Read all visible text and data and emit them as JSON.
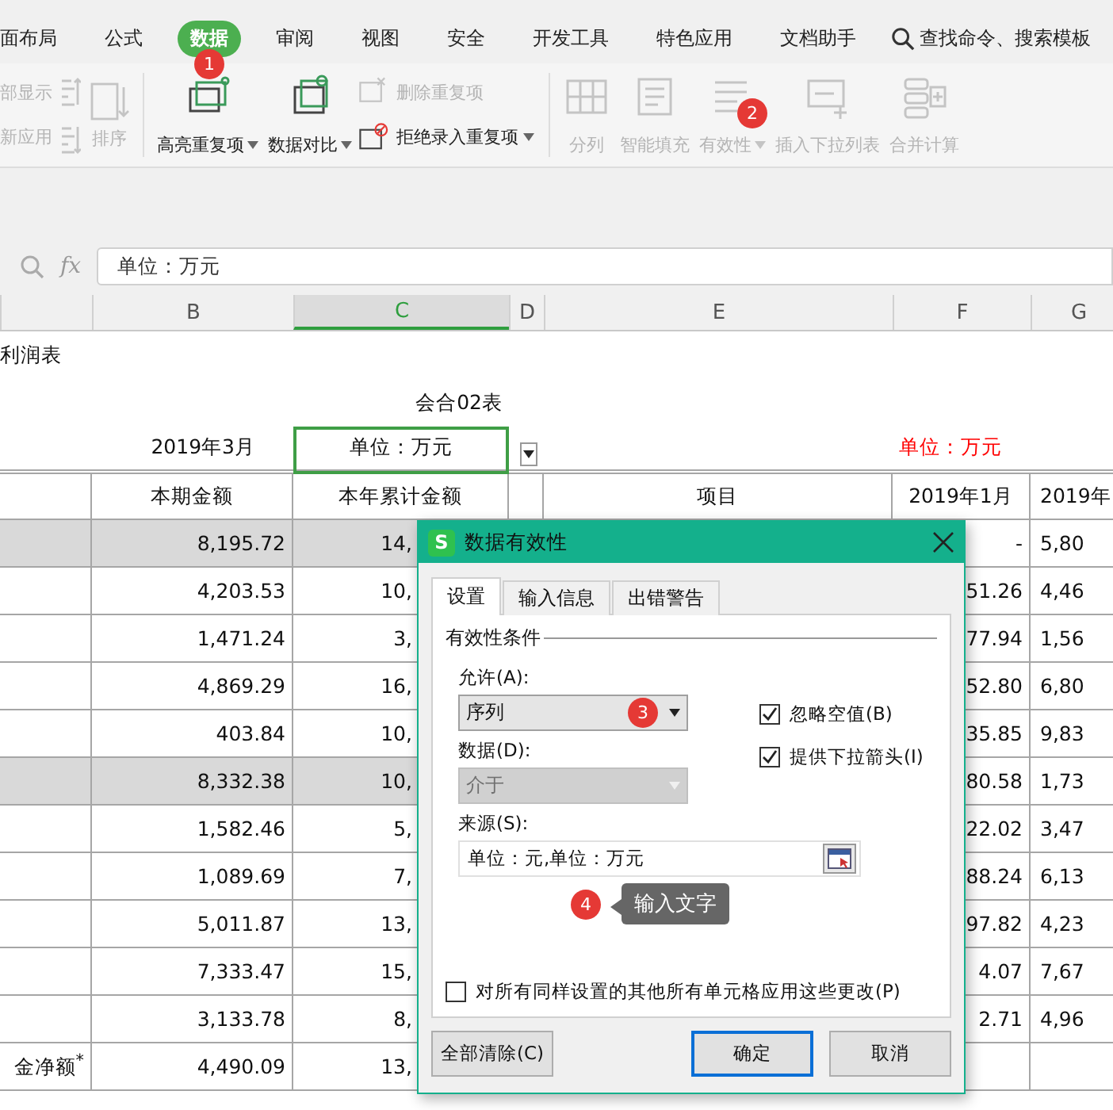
{
  "ribbon": {
    "tabs": [
      {
        "label": "面布局",
        "selected": false
      },
      {
        "label": "公式",
        "selected": false
      },
      {
        "label": "数据",
        "selected": true,
        "badge": "1"
      },
      {
        "label": "审阅",
        "selected": false
      },
      {
        "label": "视图",
        "selected": false
      },
      {
        "label": "安全",
        "selected": false
      },
      {
        "label": "开发工具",
        "selected": false
      },
      {
        "label": "特色应用",
        "selected": false
      },
      {
        "label": "文档助手",
        "selected": false
      }
    ],
    "search": {
      "placeholder": "查找命令、搜索模板"
    },
    "tools": [
      {
        "kind": "stack",
        "items": [
          {
            "label": "部显示",
            "disabled": true
          },
          {
            "label": "新应用",
            "disabled": true
          }
        ]
      },
      {
        "kind": "sort",
        "label": "排序",
        "disabled": true
      },
      {
        "kind": "separator"
      },
      {
        "kind": "large",
        "label": "高亮重复项",
        "disabled": false,
        "caret": true
      },
      {
        "kind": "large",
        "label": "数据对比",
        "disabled": false,
        "caret": true
      },
      {
        "kind": "stack",
        "items": [
          {
            "label": "删除重复项",
            "disabled": true,
            "caret": false
          },
          {
            "label": "拒绝录入重复项",
            "disabled": false,
            "caret": true
          }
        ]
      },
      {
        "kind": "separator"
      },
      {
        "kind": "large",
        "label": "分列",
        "disabled": true,
        "caret": false
      },
      {
        "kind": "large",
        "label": "智能填充",
        "disabled": true,
        "caret": false
      },
      {
        "kind": "large",
        "label": "有效性",
        "disabled": true,
        "caret": true,
        "badge": "2"
      },
      {
        "kind": "large",
        "label": "插入下拉列表",
        "disabled": true,
        "caret": false
      },
      {
        "kind": "large",
        "label": "合并计算",
        "disabled": true,
        "caret": false
      }
    ]
  },
  "formula_bar": {
    "fx": "fx",
    "value": "单位：万元"
  },
  "sheet": {
    "columns": [
      {
        "selected": false
      },
      {
        "label": "B",
        "selected": false
      },
      {
        "label": "C",
        "selected": true
      },
      {
        "label": "D",
        "selected": false
      },
      {
        "label": "E",
        "selected": false
      },
      {
        "label": "F",
        "selected": false
      },
      {
        "label": "G",
        "selected": false
      }
    ],
    "rows": [
      {
        "kind": "title",
        "shaded": false,
        "cells": [
          {
            "text": "利润表"
          },
          {
            "text": ""
          },
          {
            "text": ""
          },
          {
            "text": ""
          },
          {
            "text": ""
          },
          {
            "text": ""
          },
          {
            "text": ""
          }
        ]
      },
      {
        "kind": "plain",
        "shaded": false,
        "cells": [
          {
            "text": ""
          },
          {
            "text": ""
          },
          {
            "text": "会合02表"
          },
          {
            "text": ""
          },
          {
            "text": ""
          },
          {
            "text": ""
          },
          {
            "text": ""
          }
        ]
      },
      {
        "kind": "plain",
        "shaded": false,
        "cells": [
          {
            "text": "",
            "selected": false
          },
          {
            "text": "2019年3月",
            "selected": false
          },
          {
            "text": "单位：万元",
            "selected": true
          },
          {
            "text": "",
            "selected": false
          },
          {
            "text": "",
            "selected": false
          },
          {
            "text": "单位：万元",
            "selected": false,
            "color": "#ff0000"
          },
          {
            "text": "",
            "selected": false
          }
        ]
      },
      {
        "kind": "header",
        "shaded": false,
        "cells": [
          {
            "text": ""
          },
          {
            "text": "本期金额"
          },
          {
            "text": "本年累计金额"
          },
          {
            "text": ""
          },
          {
            "text": "项目"
          },
          {
            "text": "2019年1月"
          },
          {
            "text": "2019年"
          }
        ]
      },
      {
        "kind": "data",
        "shaded": true,
        "cells": [
          {
            "text": ""
          },
          {
            "text": "8,195.72"
          },
          {
            "text": "14,"
          },
          {
            "text": ""
          },
          {
            "text": ""
          },
          {
            "text": "-"
          },
          {
            "text": "5,80"
          }
        ]
      },
      {
        "kind": "data",
        "shaded": false,
        "cells": [
          {
            "text": ""
          },
          {
            "text": "4,203.53"
          },
          {
            "text": "10,"
          },
          {
            "text": ""
          },
          {
            "text": ""
          },
          {
            "text": "51.26"
          },
          {
            "text": "4,46"
          }
        ]
      },
      {
        "kind": "data",
        "shaded": false,
        "cells": [
          {
            "text": ""
          },
          {
            "text": "1,471.24"
          },
          {
            "text": "3,"
          },
          {
            "text": ""
          },
          {
            "text": ""
          },
          {
            "text": "77.94"
          },
          {
            "text": "1,56"
          }
        ]
      },
      {
        "kind": "data",
        "shaded": false,
        "cells": [
          {
            "text": ""
          },
          {
            "text": "4,869.29"
          },
          {
            "text": "16,"
          },
          {
            "text": ""
          },
          {
            "text": ""
          },
          {
            "text": "52.80"
          },
          {
            "text": "6,80"
          }
        ]
      },
      {
        "kind": "data",
        "shaded": false,
        "cells": [
          {
            "text": ""
          },
          {
            "text": "403.84"
          },
          {
            "text": "10,"
          },
          {
            "text": ""
          },
          {
            "text": ""
          },
          {
            "text": "35.85"
          },
          {
            "text": "9,83"
          }
        ]
      },
      {
        "kind": "data",
        "shaded": true,
        "cells": [
          {
            "text": ""
          },
          {
            "text": "8,332.38"
          },
          {
            "text": "10,"
          },
          {
            "text": ""
          },
          {
            "text": ""
          },
          {
            "text": "80.58"
          },
          {
            "text": "1,73"
          }
        ]
      },
      {
        "kind": "data",
        "shaded": false,
        "cells": [
          {
            "text": ""
          },
          {
            "text": "1,582.46"
          },
          {
            "text": "5,"
          },
          {
            "text": ""
          },
          {
            "text": ""
          },
          {
            "text": "22.02"
          },
          {
            "text": "3,47"
          }
        ]
      },
      {
        "kind": "data",
        "shaded": false,
        "cells": [
          {
            "text": ""
          },
          {
            "text": "1,089.69"
          },
          {
            "text": "7,"
          },
          {
            "text": ""
          },
          {
            "text": ""
          },
          {
            "text": "88.24"
          },
          {
            "text": "6,13"
          }
        ]
      },
      {
        "kind": "data",
        "shaded": false,
        "cells": [
          {
            "text": ""
          },
          {
            "text": "5,011.87"
          },
          {
            "text": "13,"
          },
          {
            "text": ""
          },
          {
            "text": ""
          },
          {
            "text": "97.82"
          },
          {
            "text": "4,23"
          }
        ]
      },
      {
        "kind": "data",
        "shaded": false,
        "cells": [
          {
            "text": ""
          },
          {
            "text": "7,333.47"
          },
          {
            "text": "15,"
          },
          {
            "text": ""
          },
          {
            "text": ""
          },
          {
            "text": "4.07"
          },
          {
            "text": "7,67"
          }
        ]
      },
      {
        "kind": "data",
        "shaded": false,
        "cells": [
          {
            "text": ""
          },
          {
            "text": "3,133.78"
          },
          {
            "text": "8,"
          },
          {
            "text": ""
          },
          {
            "text": ""
          },
          {
            "text": "2.71"
          },
          {
            "text": "4,96"
          }
        ]
      },
      {
        "kind": "data",
        "shaded": false,
        "cells": [
          {
            "text": "金净额$^{*}$"
          },
          {
            "text": "4,490.09"
          },
          {
            "text": "13,"
          },
          {
            "text": ""
          },
          {
            "text": ""
          },
          {
            "text": ""
          },
          {
            "text": ""
          }
        ]
      }
    ]
  },
  "dialog": {
    "logo": "S",
    "title": "数据有效性",
    "tabs": [
      {
        "label": "设置",
        "selected": true
      },
      {
        "label": "输入信息",
        "selected": false
      },
      {
        "label": "出错警告",
        "selected": false
      }
    ],
    "group": "有效性条件",
    "allow": {
      "label": "允许(A):",
      "value": "序列",
      "disabled": false,
      "badge": "3"
    },
    "data": {
      "label": "数据(D):",
      "value": "介于",
      "disabled": true
    },
    "options": [
      {
        "label": "忽略空值(B)",
        "checked": true
      },
      {
        "label": "提供下拉箭头(I)",
        "checked": true
      }
    ],
    "source": {
      "label": "来源(S):",
      "value": "单位：元,单位：万元"
    },
    "tooltip": {
      "text": "输入文字",
      "badge": "4"
    },
    "apply_all": {
      "label": "对所有同样设置的其他所有单元格应用这些更改(P)",
      "checked": false
    },
    "buttons_left": [
      {
        "label": "全部清除(C)",
        "default": false
      }
    ],
    "buttons_right": [
      {
        "label": "确定",
        "default": true
      },
      {
        "label": "取消",
        "default": false
      }
    ]
  }
}
